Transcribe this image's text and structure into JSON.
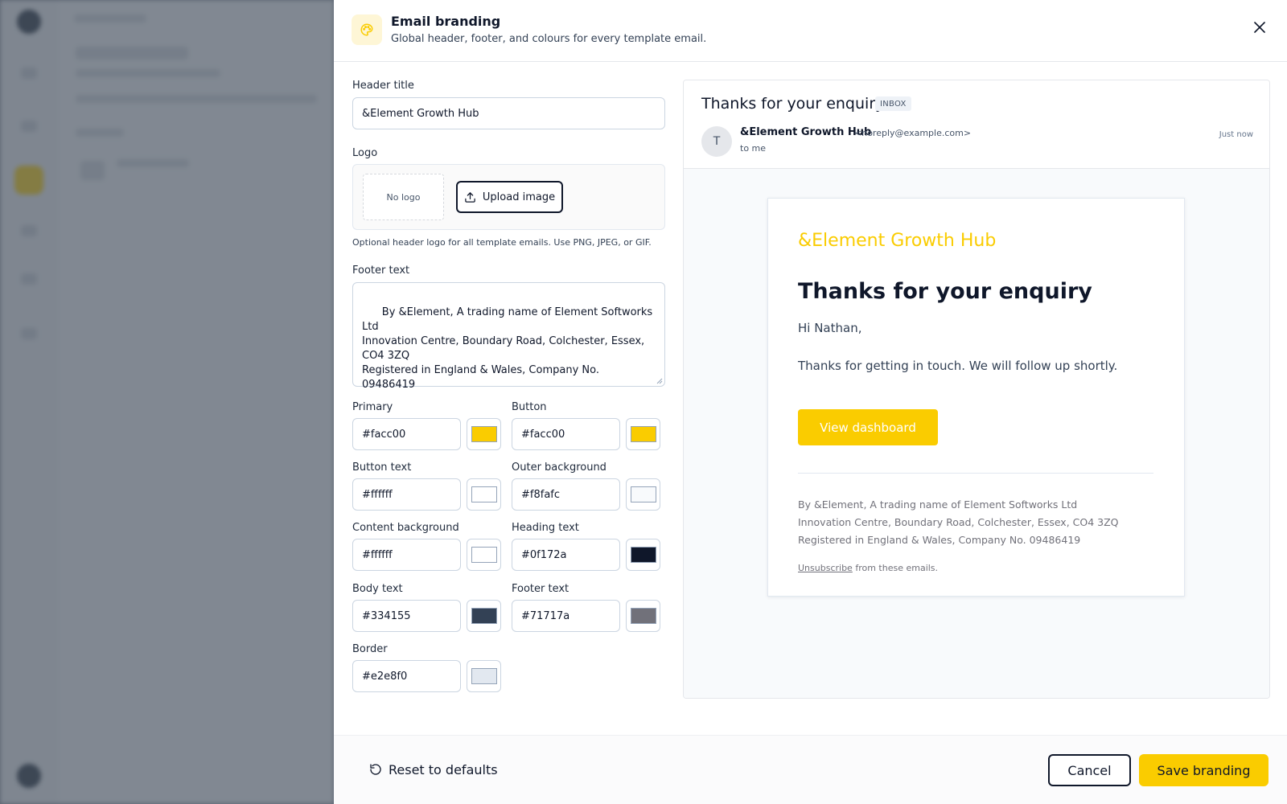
{
  "panel": {
    "title": "Email branding",
    "subtitle": "Global header, footer, and colours for every template email.",
    "header_icon": "palette-icon",
    "close_icon": "close-icon"
  },
  "form": {
    "header_title_label": "Header title",
    "header_title_value": "&Element Growth Hub",
    "logo_label": "Logo",
    "no_logo_text": "No logo",
    "upload_label": "Upload image",
    "logo_hint": "Optional header logo for all template emails. Use PNG, JPEG, or GIF.",
    "footer_label": "Footer text",
    "footer_value": "By &Element, A trading name of Element Softworks Ltd\nInnovation Centre, Boundary Road, Colchester, Essex, CO4 3ZQ\nRegistered in England & Wales, Company No. 09486419",
    "colors": [
      {
        "label": "Primary",
        "value": "#facc00"
      },
      {
        "label": "Button",
        "value": "#facc00"
      },
      {
        "label": "Button text",
        "value": "#ffffff"
      },
      {
        "label": "Outer background",
        "value": "#f8fafc"
      },
      {
        "label": "Content background",
        "value": "#ffffff"
      },
      {
        "label": "Heading text",
        "value": "#0f172a"
      },
      {
        "label": "Body text",
        "value": "#334155"
      },
      {
        "label": "Footer text",
        "value": "#71717a"
      },
      {
        "label": "Border",
        "value": "#e2e8f0"
      }
    ]
  },
  "preview": {
    "subject": "Thanks for your enquiry",
    "badge": "INBOX",
    "avatar_initial": "T",
    "from_name": "&Element Growth Hub",
    "from_email": "<noreply@example.com>",
    "to": "to me",
    "time": "Just now",
    "email": {
      "brand": "&Element Growth Hub",
      "heading": "Thanks for your enquiry",
      "greeting": "Hi Nathan,",
      "body": "Thanks for getting in touch. We will follow up shortly.",
      "button": "View dashboard",
      "footer": "By &Element, A trading name of Element Softworks Ltd\nInnovation Centre, Boundary Road, Colchester, Essex, CO4 3ZQ\nRegistered in England & Wales, Company No. 09486419",
      "unsubscribe_link": "Unsubscribe",
      "unsubscribe_rest": " from these emails."
    }
  },
  "footer": {
    "reset_label": "Reset to defaults",
    "cancel_label": "Cancel",
    "save_label": "Save branding"
  }
}
